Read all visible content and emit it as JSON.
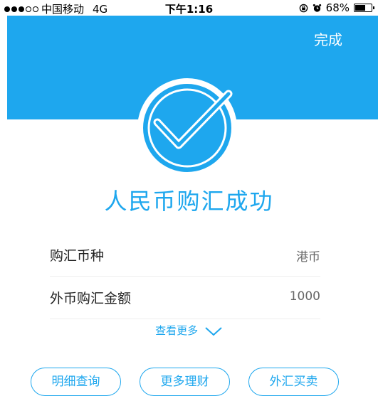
{
  "status_bar": {
    "carrier": "中国移动",
    "network": "4G",
    "time": "下午1:16",
    "battery_percent": "68%",
    "battery_level": 0.68,
    "signal_bars_filled": 3,
    "signal_bars_total": 5
  },
  "header": {
    "done_label": "完成",
    "background_color": "#1ea7ee"
  },
  "result": {
    "title": "人民币购汇成功",
    "icon": "check-circle-icon"
  },
  "details": [
    {
      "label": "购汇币种",
      "value": "港币"
    },
    {
      "label": "外币购汇金额",
      "value": "1000"
    }
  ],
  "more_label": "查看更多",
  "actions": [
    {
      "label": "明细查询"
    },
    {
      "label": "更多理财"
    },
    {
      "label": "外汇买卖"
    }
  ],
  "colors": {
    "accent": "#1ea7ee",
    "text_primary": "#222222",
    "text_secondary": "#666666"
  }
}
